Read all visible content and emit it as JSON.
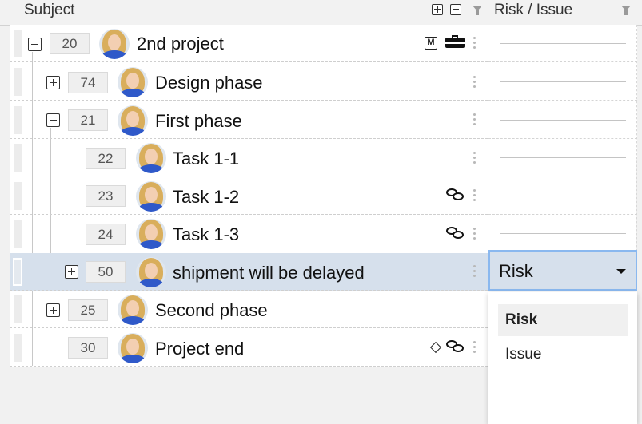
{
  "header": {
    "subject_label": "Subject",
    "risk_issue_label": "Risk / Issue",
    "expand_all_icon": "plus-square-icon",
    "collapse_all_icon": "minus-square-icon",
    "filter_icon": "funnel-icon"
  },
  "rows": [
    {
      "id": "20",
      "subject": "2nd project",
      "toggle": "collapse",
      "icons": [
        "m-icon",
        "briefcase-icon"
      ]
    },
    {
      "id": "74",
      "subject": "Design phase",
      "toggle": "expand",
      "icons": []
    },
    {
      "id": "21",
      "subject": "First phase",
      "toggle": "collapse",
      "icons": []
    },
    {
      "id": "22",
      "subject": "Task 1-1",
      "toggle": "none",
      "icons": []
    },
    {
      "id": "23",
      "subject": "Task 1-2",
      "toggle": "none",
      "icons": [
        "comments-icon"
      ]
    },
    {
      "id": "24",
      "subject": "Task 1-3",
      "toggle": "none",
      "icons": [
        "comments-icon"
      ]
    },
    {
      "id": "50",
      "subject": "shipment will be delayed",
      "toggle": "expand",
      "icons": [],
      "selected": true
    },
    {
      "id": "25",
      "subject": "Second phase",
      "toggle": "expand",
      "icons": []
    },
    {
      "id": "30",
      "subject": "Project end",
      "toggle": "none",
      "icons": [
        "milestone-diamond-icon",
        "comments-icon"
      ]
    }
  ],
  "risk_select": {
    "value": "Risk",
    "options": [
      "Risk",
      "Issue",
      ""
    ]
  },
  "icon_glyphs": {
    "m_icon": "M"
  },
  "colors": {
    "selected_row": "#d6e0ec",
    "focus_border": "#8ab8ef",
    "avatar_shirt": "#2f59c9"
  }
}
